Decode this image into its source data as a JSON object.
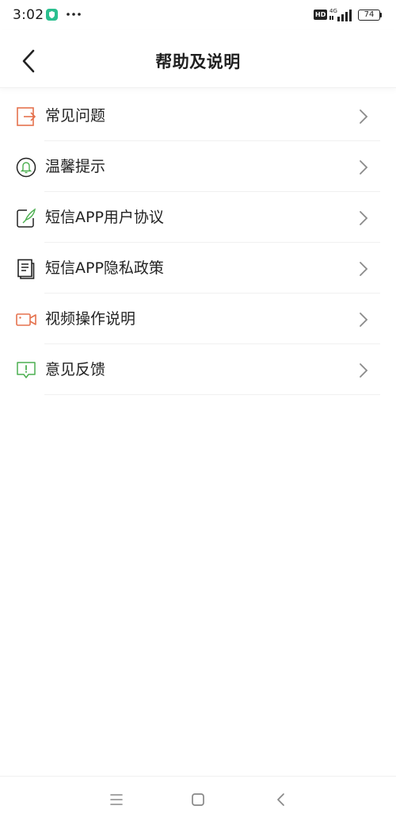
{
  "status_bar": {
    "time": "3:02",
    "network": "4G",
    "hd_label": "HD",
    "battery": "74"
  },
  "header": {
    "title": "帮助及说明"
  },
  "menu": {
    "items": [
      {
        "label": "常见问题",
        "icon": "exit-box-icon",
        "icon_color": "#e5724e"
      },
      {
        "label": "温馨提示",
        "icon": "bell-icon",
        "icon_color": "#222222"
      },
      {
        "label": "短信APP用户协议",
        "icon": "edit-document-icon",
        "icon_color": "#4caf50"
      },
      {
        "label": "短信APP隐私政策",
        "icon": "document-icon",
        "icon_color": "#222222"
      },
      {
        "label": "视频操作说明",
        "icon": "video-camera-icon",
        "icon_color": "#e5724e"
      },
      {
        "label": "意见反馈",
        "icon": "feedback-icon",
        "icon_color": "#4caf50"
      }
    ]
  },
  "nav_bar": {
    "buttons": [
      "menu-icon",
      "home-icon",
      "back-icon"
    ]
  },
  "colors": {
    "accent_orange": "#e5724e",
    "accent_green": "#4caf50",
    "shield_green": "#2bbf8f"
  }
}
